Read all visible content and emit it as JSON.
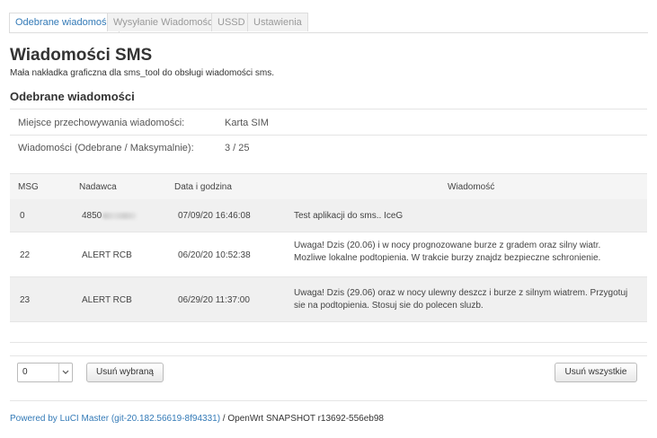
{
  "tabs": [
    {
      "label": "Odebrane wiadomości",
      "active": true
    },
    {
      "label": "Wysyłanie Wiadomości",
      "active": false
    },
    {
      "label": "USSD",
      "active": false
    },
    {
      "label": "Ustawienia",
      "active": false
    }
  ],
  "page": {
    "title": "Wiadomości SMS",
    "subtitle": "Mała nakładka graficzna dla sms_tool do obsługi wiadomości sms.",
    "section_title": "Odebrane wiadomości"
  },
  "info": {
    "storage_label": "Miejsce przechowywania wiadomości:",
    "storage_value": "Karta SIM",
    "count_label": "Wiadomości (Odebrane / Maksymalnie):",
    "count_value": "3 / 25"
  },
  "table": {
    "headers": [
      "MSG",
      "Nadawca",
      "Data i godzina",
      "Wiadomość"
    ],
    "rows": [
      {
        "msg": "0",
        "sender": "4850",
        "date": "07/09/20 16:46:08",
        "text": "Test aplikacji do sms.. IceG"
      },
      {
        "msg": "22",
        "sender": "ALERT RCB",
        "date": "06/20/20 10:52:38",
        "text": "Uwaga! Dzis (20.06) i w nocy prognozowane burze z gradem oraz silny wiatr. Mozliwe lokalne podtopienia. W trakcie burzy znajdz bezpieczne schronienie."
      },
      {
        "msg": "23",
        "sender": "ALERT RCB",
        "date": "06/29/20 11:37:00",
        "text": "Uwaga! Dzis (29.06) oraz w nocy ulewny deszcz i burze z silnym wiatrem. Przygotuj sie na podtopienia. Stosuj sie do polecen sluzb."
      }
    ]
  },
  "actions": {
    "select_value": "0",
    "delete_selected": "Usuń wybraną",
    "delete_all": "Usuń wszystkie"
  },
  "footer": {
    "link_text": "Powered by LuCI Master (git-20.182.56619-8f94331)",
    "text": " / OpenWrt SNAPSHOT r13692-556eb98"
  }
}
